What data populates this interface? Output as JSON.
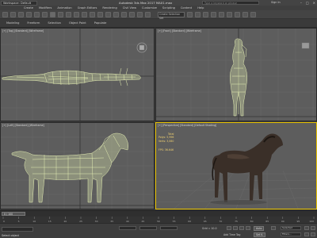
{
  "titlebar": {
    "workspace": "Workspace: Default",
    "title": "Autodesk 3ds Max 2017     MAX1.max",
    "search_placeholder": "Type a keyword or phrase",
    "signin": "Sign In",
    "window_buttons": [
      "–",
      "□",
      "×"
    ]
  },
  "menubar": {
    "items": [
      "Create",
      "Modifiers",
      "Animation",
      "Graph Editors",
      "Rendering",
      "Civil View",
      "Customize",
      "Scripting",
      "Content",
      "Help"
    ]
  },
  "toolbar": {
    "selection_set": "Create Selection Set"
  },
  "ribbon": {
    "tabs": [
      "Modeling",
      "Freeform",
      "Selection",
      "Object Paint",
      "Populate"
    ]
  },
  "viewports": {
    "top": {
      "label": "[+] [Top] [Standard] [Wireframe]"
    },
    "front": {
      "label": "[+] [Front] [Standard] [Wireframe]"
    },
    "left": {
      "label": "[+] [Left] [Standard] [Wireframe]"
    },
    "perspective": {
      "label": "[+] [Perspective] [Standard] [Default Shading]",
      "stats_header": "Total",
      "polys_label": "Polys:",
      "polys_value": "5,996",
      "verts_label": "Verts:",
      "verts_value": "3,060",
      "fps_label": "FPS:",
      "fps_value": "36.646"
    }
  },
  "timeline": {
    "slider": "0 / 100",
    "ticks": [
      "0",
      "5",
      "10",
      "15",
      "20",
      "25",
      "30",
      "35",
      "40",
      "45",
      "50",
      "55",
      "60",
      "65",
      "70",
      "75",
      "80",
      "85",
      "90",
      "95",
      "100"
    ]
  },
  "statusbar": {
    "message": "Select object",
    "x_value": "",
    "y_value": "",
    "z_value": "",
    "grid": "Grid = 10.0",
    "add_time_tag": "Add Time Tag",
    "auto_key": "Auto",
    "set_key": "Set K.",
    "selected": "Selected",
    "filters": "Filters..."
  },
  "colors": {
    "wire": "#e6f0b4",
    "viewport_bg": "#5d5d5d",
    "active_border": "#e8c200",
    "stats": "#f0d070",
    "horse_body": "#3a2f28"
  }
}
